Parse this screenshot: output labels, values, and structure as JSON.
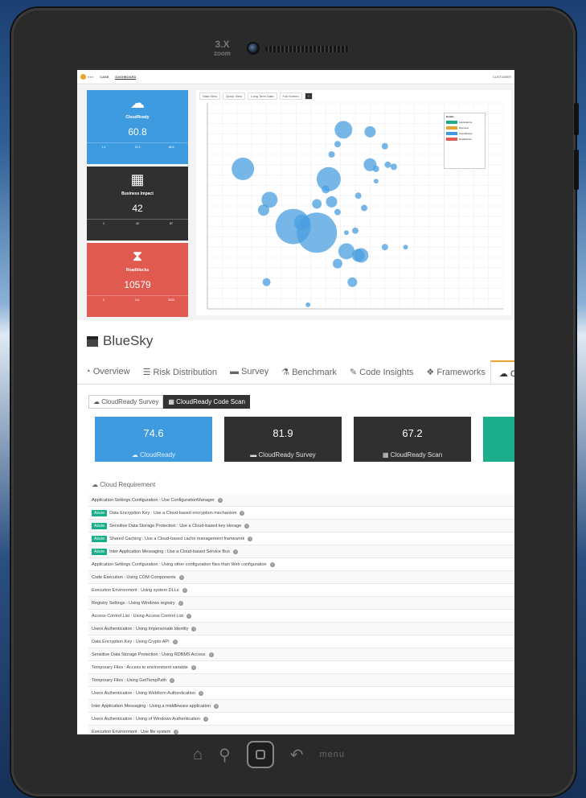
{
  "device": {
    "brand": "3.X",
    "brand_sub": "zoom",
    "menu_label": "menu"
  },
  "topnav": {
    "items": [
      "CASE",
      "DASHBOARD"
    ],
    "right": "CUSTOMER"
  },
  "tiles": [
    {
      "title": "CloudReady",
      "value": "60.8",
      "color": "#3e9be0",
      "icon": "cloud-icon",
      "stats": [
        "1.1",
        "15.3",
        "48.6"
      ]
    },
    {
      "title": "Business Impact",
      "value": "42",
      "color": "#303030",
      "icon": "building-icon",
      "stats": [
        "1",
        "42",
        "67"
      ]
    },
    {
      "title": "Roadblocks",
      "value": "10579",
      "color": "#e05a4f",
      "icon": "hourglass-icon",
      "stats": [
        "0",
        "511",
        "3000"
      ]
    }
  ],
  "chart_toolbar": [
    "Data View",
    "Quick View",
    "Long Term Data",
    "Full Screen"
  ],
  "chart_data": {
    "type": "scatter",
    "xlim": [
      0,
      100
    ],
    "ylim": [
      0,
      100
    ],
    "grid": true,
    "points": [
      {
        "x": 12,
        "y": 68,
        "r": 14
      },
      {
        "x": 21,
        "y": 53,
        "r": 10
      },
      {
        "x": 19,
        "y": 48,
        "r": 7
      },
      {
        "x": 29,
        "y": 40,
        "r": 22
      },
      {
        "x": 32,
        "y": 42,
        "r": 10
      },
      {
        "x": 37,
        "y": 37,
        "r": 25
      },
      {
        "x": 37,
        "y": 51,
        "r": 6
      },
      {
        "x": 40,
        "y": 58,
        "r": 5
      },
      {
        "x": 41,
        "y": 63,
        "r": 15
      },
      {
        "x": 42,
        "y": 52,
        "r": 7
      },
      {
        "x": 42,
        "y": 75,
        "r": 4
      },
      {
        "x": 44,
        "y": 47,
        "r": 4
      },
      {
        "x": 44,
        "y": 80,
        "r": 4
      },
      {
        "x": 46,
        "y": 87,
        "r": 11
      },
      {
        "x": 47,
        "y": 28,
        "r": 10
      },
      {
        "x": 44,
        "y": 22,
        "r": 6
      },
      {
        "x": 49,
        "y": 13,
        "r": 6
      },
      {
        "x": 51,
        "y": 26,
        "r": 8
      },
      {
        "x": 52,
        "y": 26,
        "r": 9
      },
      {
        "x": 51,
        "y": 55,
        "r": 4
      },
      {
        "x": 50,
        "y": 38,
        "r": 4
      },
      {
        "x": 53,
        "y": 49,
        "r": 4
      },
      {
        "x": 55,
        "y": 86,
        "r": 7
      },
      {
        "x": 55,
        "y": 70,
        "r": 8
      },
      {
        "x": 57,
        "y": 68,
        "r": 4
      },
      {
        "x": 60,
        "y": 79,
        "r": 4
      },
      {
        "x": 61,
        "y": 70,
        "r": 4
      },
      {
        "x": 63,
        "y": 69,
        "r": 4
      },
      {
        "x": 57,
        "y": 62,
        "r": 3
      },
      {
        "x": 60,
        "y": 30,
        "r": 4
      },
      {
        "x": 67,
        "y": 30,
        "r": 3
      },
      {
        "x": 47,
        "y": 37,
        "r": 3
      },
      {
        "x": 34,
        "y": 2,
        "r": 3
      },
      {
        "x": 20,
        "y": 13,
        "r": 5
      }
    ]
  },
  "legend": {
    "title": "Details",
    "rows": [
      "Applications",
      "Business",
      "CloudReady",
      "Roadblocks"
    ]
  },
  "project": {
    "title": "BlueSky",
    "tabs": [
      {
        "label": "Overview",
        "icon": "dashboard-icon"
      },
      {
        "label": "Risk Distribution",
        "icon": "list-icon"
      },
      {
        "label": "Survey",
        "icon": "drive-icon"
      },
      {
        "label": "Benchmark",
        "icon": "flask-icon"
      },
      {
        "label": "Code Insights",
        "icon": "pen-icon"
      },
      {
        "label": "Frameworks",
        "icon": "cubes-icon"
      },
      {
        "label": "Cloud",
        "icon": "cloud-icon"
      }
    ],
    "subtabs": [
      "CloudReady Survey",
      "CloudReady Code Scan"
    ],
    "scores": [
      {
        "value": "74.6",
        "label": "CloudReady",
        "color": "#3e9be0"
      },
      {
        "value": "81.9",
        "label": "CloudReady Survey",
        "color": "#303030"
      },
      {
        "value": "67.2",
        "label": "CloudReady Scan",
        "color": "#303030"
      },
      {
        "value": "",
        "label": "",
        "color": "#1aaf8a"
      }
    ],
    "requirement_heading": "Cloud Requirement",
    "requirements": [
      {
        "badge": "",
        "text": "Application Settings Configuration : Use ConfigurationManager"
      },
      {
        "badge": "Azure",
        "text": "Data Encryption Key : Use a Cloud-based encryption mechanism"
      },
      {
        "badge": "Azure",
        "text": "Sensitive Data Storage Protection : Use a Cloud-based key storage"
      },
      {
        "badge": "Azure",
        "text": "Shared Caching : Use a Cloud-based cache management framework"
      },
      {
        "badge": "Azure",
        "text": "Inter Application Messaging : Use a Cloud-based Service Bus"
      },
      {
        "badge": "",
        "text": "Application Settings Configuration : Using other configuration files than Web configuration"
      },
      {
        "badge": "",
        "text": "Code Execution : Using COM Components"
      },
      {
        "badge": "",
        "text": "Execution Environment : Using system DLLs"
      },
      {
        "badge": "",
        "text": "Registry Settings : Using Windows registry"
      },
      {
        "badge": "",
        "text": "Access Control List : Using Access Control List"
      },
      {
        "badge": "",
        "text": "Users Authentication : Using Impersonate Identity"
      },
      {
        "badge": "",
        "text": "Data Encryption Key : Using Crypto API"
      },
      {
        "badge": "",
        "text": "Sensitive Data Storage Protection : Using RDBMS Access"
      },
      {
        "badge": "",
        "text": "Temporary Files : Access to environment variable"
      },
      {
        "badge": "",
        "text": "Temporary Files : Using GetTempPath"
      },
      {
        "badge": "",
        "text": "Users Authentication : Using Webform Authentication"
      },
      {
        "badge": "",
        "text": "Inter Application Messaging : Using a middleware application"
      },
      {
        "badge": "",
        "text": "Users Authentication : Using of Windows Authentication"
      },
      {
        "badge": "",
        "text": "Execution Environment : Use file system"
      }
    ]
  }
}
